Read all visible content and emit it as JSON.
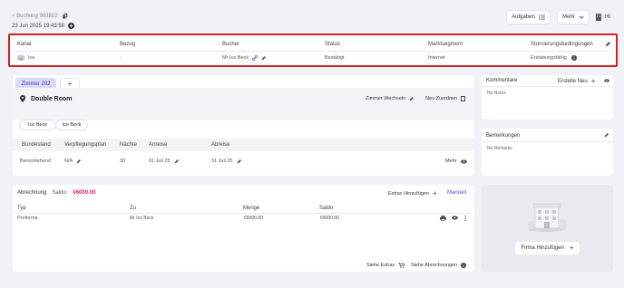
{
  "header": {
    "back_link": "< Buchung 993802",
    "datetime": "23 Jun 2025 19:43:59",
    "tasks_label": "Aufgaben",
    "more_label": "Mehr",
    "user_initials": "HI"
  },
  "booking_summary": {
    "columns": [
      "Kanal",
      "Bezug",
      "Bucher",
      "Status",
      "Marktsegment",
      "Stornierungsbedingungen"
    ],
    "values": {
      "channel": "Ice",
      "reference": "-",
      "booker": "Mr Ice Beck",
      "status": "Bestätigt",
      "market_segment": "Internet",
      "cancellation": "Erstattungsfähig"
    }
  },
  "room": {
    "tab_label": "Zimmer 202",
    "add_tab_label": "+",
    "room_type": "Double Room",
    "change_room_label": "Zimmer Wechseln",
    "reassign_label": "Neu Zuordnen",
    "guests": [
      "Ice Beck",
      "Ice Beck"
    ],
    "table_headers": [
      "Bundesland",
      "Verpflegungsplan",
      "Nächte",
      "Anreise",
      "Abreise"
    ],
    "row": {
      "state": "Bevorstehend",
      "meal_plan": "N/A",
      "nights": "30",
      "arrival": "01 Juli 25",
      "departure": "31 Juli 25"
    },
    "more_label": "Mehr"
  },
  "billing": {
    "title": "Abrechnung",
    "balance_label": "Saldo:",
    "balance_value": "€6000.00",
    "add_extras_label": "Extras Hinzufügen",
    "manual_label": "Manuell",
    "table_headers": [
      "Typ",
      "Zu",
      "Menge",
      "Saldo"
    ],
    "row": {
      "type": "Proforma",
      "to": "Mr Ice Beck",
      "amount": "€6000.00",
      "balance": "€6000.00"
    },
    "see_extras_label": "Siehe Extras",
    "see_billing_label": "Siehe Abrechnungen"
  },
  "comments": {
    "title": "Kommentare",
    "new_label": "Erstelle Neu",
    "empty": "No Notes"
  },
  "remarks": {
    "title": "Bemerkungen",
    "empty": "No Remarks"
  },
  "company": {
    "add_label": "Firma Hinzufügen"
  },
  "colors": {
    "highlight_border": "#d32027",
    "accent_purple": "#5b4fd9",
    "balance_pink": "#e0197d",
    "tab_bg": "#dcdbf7"
  }
}
